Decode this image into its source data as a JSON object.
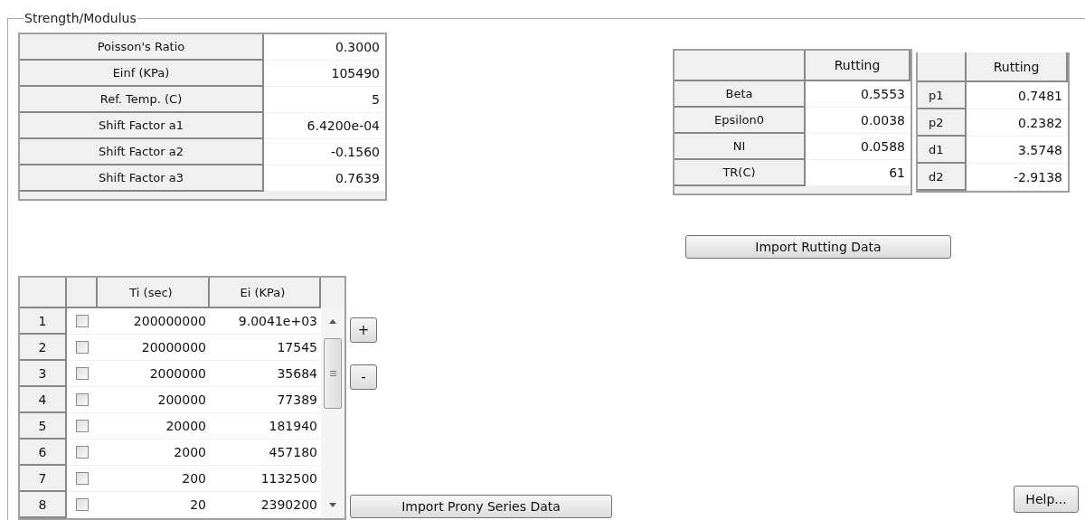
{
  "group_title": "Strength/Modulus",
  "modulus_table": {
    "rows": [
      {
        "label": "Poisson's Ratio",
        "value": "0.3000"
      },
      {
        "label": "Einf (KPa)",
        "value": "105490"
      },
      {
        "label": "Ref. Temp. (C)",
        "value": "5"
      },
      {
        "label": "Shift Factor a1",
        "value": "6.4200e-04"
      },
      {
        "label": "Shift Factor a2",
        "value": "-0.1560"
      },
      {
        "label": "Shift Factor a3",
        "value": "0.7639"
      }
    ]
  },
  "rutting_table_1": {
    "column": "Rutting",
    "rows": [
      {
        "label": "Beta",
        "value": "0.5553"
      },
      {
        "label": "Epsilon0",
        "value": "0.0038"
      },
      {
        "label": "NI",
        "value": "0.0588"
      },
      {
        "label": "TR(C)",
        "value": "61"
      }
    ]
  },
  "rutting_table_2": {
    "column": "Rutting",
    "rows": [
      {
        "label": "p1",
        "value": "0.7481"
      },
      {
        "label": "p2",
        "value": "0.2382"
      },
      {
        "label": "d1",
        "value": "3.5748"
      },
      {
        "label": "d2",
        "value": "-2.9138"
      }
    ]
  },
  "import_rutting_button": "Import Rutting Data",
  "prony_table": {
    "columns": [
      "Ti (sec)",
      "Ei (KPa)"
    ],
    "rows": [
      {
        "index": "1",
        "checked": false,
        "ti": "200000000",
        "ei": "9.0041e+03"
      },
      {
        "index": "2",
        "checked": false,
        "ti": "20000000",
        "ei": "17545"
      },
      {
        "index": "3",
        "checked": false,
        "ti": "2000000",
        "ei": "35684"
      },
      {
        "index": "4",
        "checked": false,
        "ti": "200000",
        "ei": "77389"
      },
      {
        "index": "5",
        "checked": false,
        "ti": "20000",
        "ei": "181940"
      },
      {
        "index": "6",
        "checked": false,
        "ti": "2000",
        "ei": "457180"
      },
      {
        "index": "7",
        "checked": false,
        "ti": "200",
        "ei": "1132500"
      },
      {
        "index": "8",
        "checked": false,
        "ti": "20",
        "ei": "2390200"
      }
    ]
  },
  "add_button": "+",
  "remove_button": "-",
  "import_prony_button": "Import Prony Series Data",
  "help_button": "Help..."
}
